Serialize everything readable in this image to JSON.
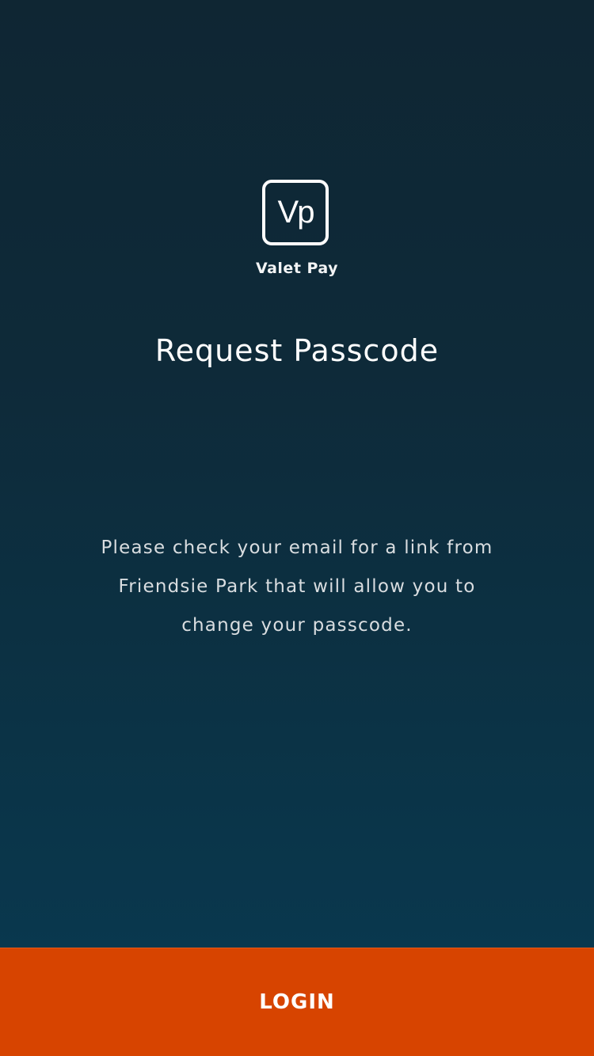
{
  "app": {
    "logo_text": "Vp",
    "name": "Valet Pay"
  },
  "page": {
    "title": "Request Passcode",
    "message_lines": [
      "Please check your email for a link from",
      "Friendsie Park that will allow you to",
      "change your passcode."
    ]
  },
  "actions": {
    "login_label": "LOGIN"
  },
  "colors": {
    "background_top": "#0f2633",
    "background_bottom": "#083a52",
    "button": "#d74400",
    "text": "#ffffff"
  }
}
